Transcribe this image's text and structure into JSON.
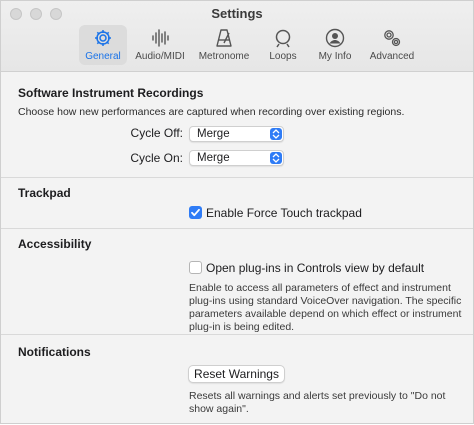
{
  "window": {
    "title": "Settings"
  },
  "toolbar": {
    "tabs": [
      {
        "label": "General",
        "icon": "gear-icon",
        "active": true
      },
      {
        "label": "Audio/MIDI",
        "icon": "waveform-icon",
        "active": false
      },
      {
        "label": "Metronome",
        "icon": "metronome-icon",
        "active": false
      },
      {
        "label": "Loops",
        "icon": "loop-icon",
        "active": false
      },
      {
        "label": "My Info",
        "icon": "person-icon",
        "active": false
      },
      {
        "label": "Advanced",
        "icon": "gears-icon",
        "active": false
      }
    ]
  },
  "software_instrument": {
    "title": "Software Instrument Recordings",
    "description": "Choose how new performances are captured when recording over existing regions.",
    "cycle_off": {
      "label": "Cycle Off:",
      "value": "Merge"
    },
    "cycle_on": {
      "label": "Cycle On:",
      "value": "Merge"
    }
  },
  "trackpad": {
    "title": "Trackpad",
    "force_touch": {
      "label": "Enable Force Touch trackpad",
      "checked": true
    }
  },
  "accessibility": {
    "title": "Accessibility",
    "plugins_controls": {
      "label": "Open plug-ins in Controls view by default",
      "checked": false
    },
    "help": [
      "Enable to access all parameters of effect and instrument",
      "plug-ins using standard VoiceOver navigation. The specific",
      "parameters available depend on which effect or instrument",
      "plug-in is being edited."
    ]
  },
  "notifications": {
    "title": "Notifications",
    "reset_button": "Reset Warnings",
    "help": [
      "Resets all warnings and alerts set previously to \"Do not",
      "show again\"."
    ]
  },
  "colors": {
    "accent": "#2f7cf6",
    "active_tab_label": "#1a73e8"
  }
}
